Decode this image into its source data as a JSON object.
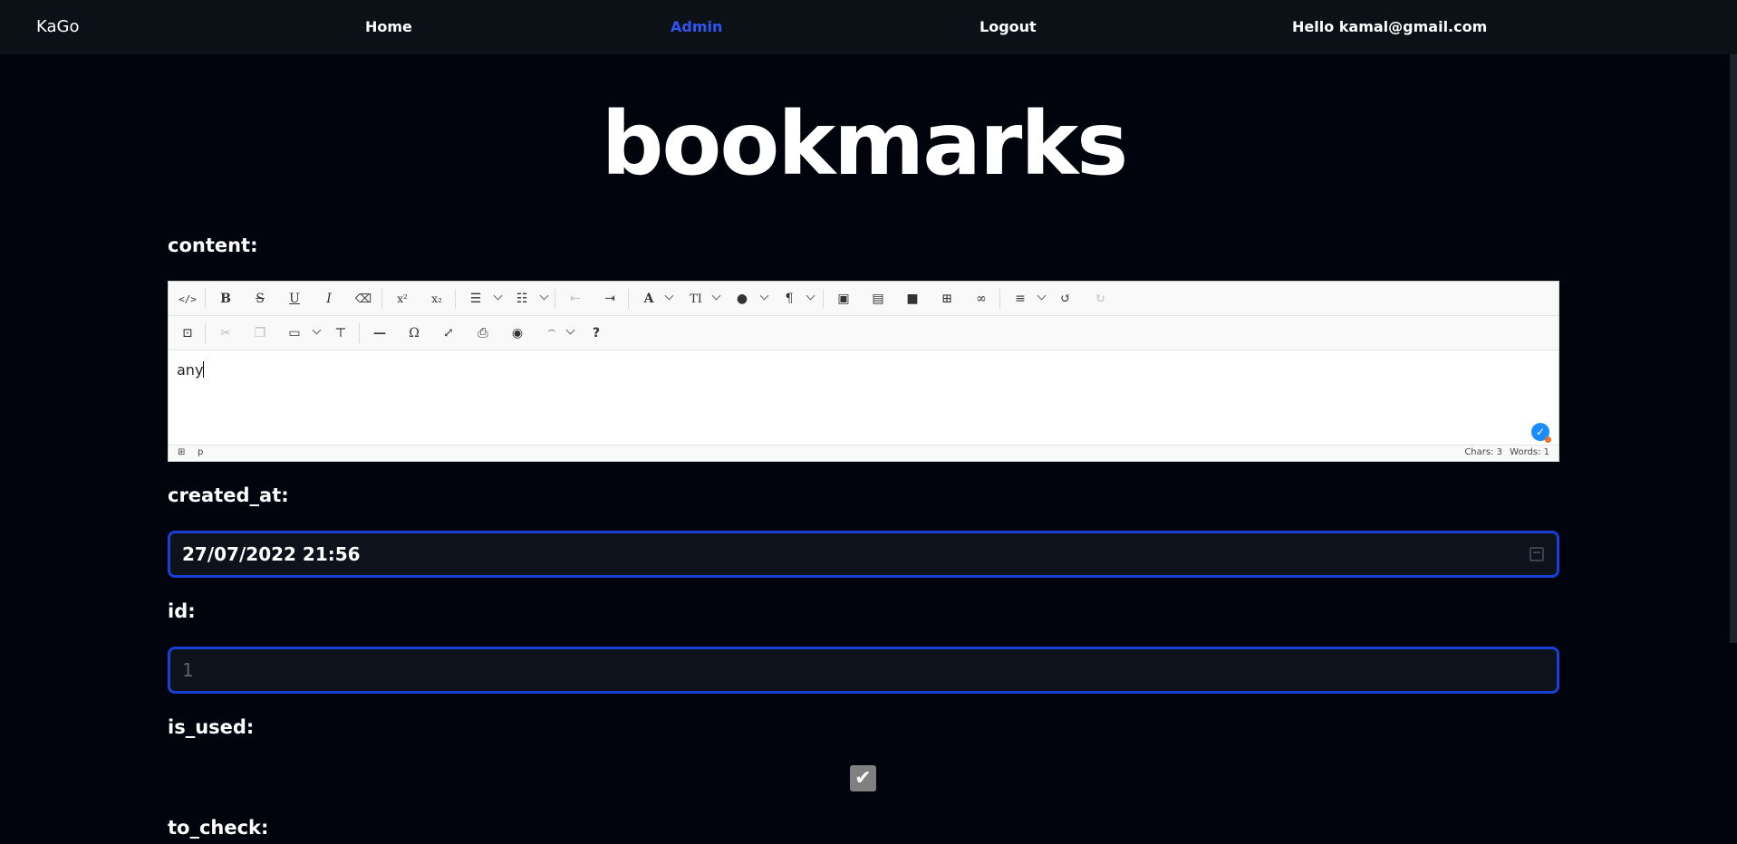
{
  "navbar": {
    "brand": "KaGo",
    "home": "Home",
    "admin": "Admin",
    "logout": "Logout",
    "hello": "Hello kamal@gmail.com",
    "active_color": "#2f56f4"
  },
  "page": {
    "title": "bookmarks"
  },
  "fields": {
    "content_label": "content:",
    "created_at_label": "created_at:",
    "id_label": "id:",
    "is_used_label": "is_used:",
    "to_check_label": "to_check:"
  },
  "editor": {
    "text": "any",
    "status_path": "⊞",
    "status_tag": "p",
    "chars": "Chars: 3",
    "words": "Words: 1",
    "toolbar_row1_icons": [
      "source-icon",
      "bold-icon",
      "strikethrough-icon",
      "underline-icon",
      "italic-icon",
      "eraser-icon",
      "superscript-icon",
      "subscript-icon",
      "bullet-list-icon",
      "numbered-list-icon",
      "outdent-icon",
      "indent-icon",
      "font-icon",
      "font-size-icon",
      "brush-icon",
      "paragraph-icon",
      "image-icon",
      "file-icon",
      "video-icon",
      "table-icon",
      "link-icon",
      "align-icon",
      "undo-icon",
      "redo-icon"
    ],
    "toolbar_row2_icons": [
      "select-all-icon",
      "cut-icon",
      "copy-icon",
      "paste-icon",
      "format-painter-icon",
      "hr-icon",
      "symbol-icon",
      "fullsize-icon",
      "print-icon",
      "preview-icon",
      "more-icon",
      "help-icon"
    ]
  },
  "inputs": {
    "created_at_value": "27/07/2022 21:56",
    "id_placeholder": "1",
    "is_used_checked": true
  },
  "colors": {
    "background": "#02040d",
    "navbar": "#0c1118",
    "input_border": "#1a3fd6"
  }
}
